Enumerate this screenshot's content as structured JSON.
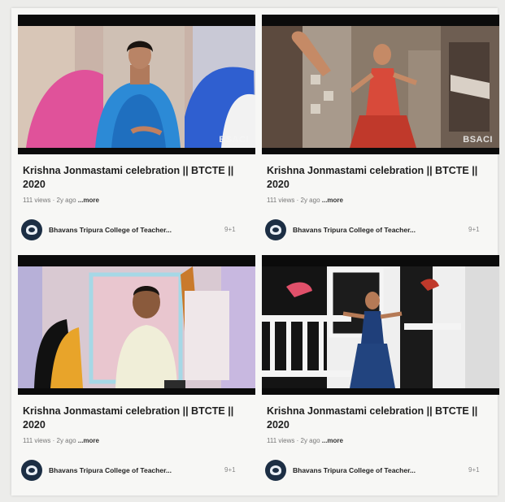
{
  "watermark": "BSACI",
  "videos": [
    {
      "title": "Krishna Jonmastami celebration || BTCTE || 2020",
      "meta": "111 views · 2y ago",
      "more": "...more",
      "channel": "Bhavans Tripura College of Teacher...",
      "extra": "9+1"
    },
    {
      "title": "Krishna Jonmastami celebration || BTCTE || 2020",
      "meta": "111 views · 2y ago",
      "more": "...more",
      "channel": "Bhavans Tripura College of Teacher...",
      "extra": "9+1"
    },
    {
      "title": "Krishna Jonmastami celebration || BTCTE || 2020",
      "meta": "111 views · 2y ago",
      "more": "...more",
      "channel": "Bhavans Tripura College of Teacher...",
      "extra": "9+1"
    },
    {
      "title": "Krishna Jonmastami celebration || BTCTE || 2020",
      "meta": "111 views · 2y ago",
      "more": "...more",
      "channel": "Bhavans Tripura College of Teacher...",
      "extra": "9+1"
    }
  ]
}
